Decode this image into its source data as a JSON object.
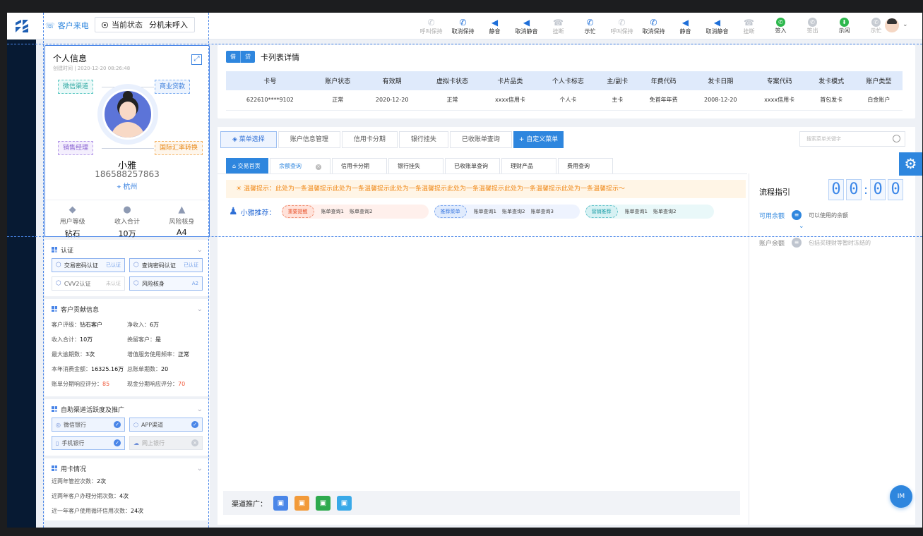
{
  "topbar": {
    "caller_label": "客户来电",
    "status_label": "当前状态",
    "status_value": "分机未呼入",
    "buttons": [
      {
        "label": "呼叫保持",
        "icon": "phone-hold-icon",
        "enabled": false
      },
      {
        "label": "取消保持",
        "icon": "phone-unhold-icon",
        "enabled": true
      },
      {
        "label": "静音",
        "icon": "mute-icon",
        "enabled": true
      },
      {
        "label": "取消静音",
        "icon": "unmute-icon",
        "enabled": true
      },
      {
        "label": "挂断",
        "icon": "hangup-icon",
        "enabled": false
      },
      {
        "label": "示忙",
        "icon": "busy-icon",
        "enabled": true
      },
      {
        "label": "呼叫保持",
        "icon": "phone-hold-icon",
        "enabled": false
      },
      {
        "label": "取消保持",
        "icon": "phone-unhold-icon",
        "enabled": true
      },
      {
        "label": "静音",
        "icon": "mute-icon",
        "enabled": true
      },
      {
        "label": "取消静音",
        "icon": "unmute-icon",
        "enabled": true
      },
      {
        "label": "挂断",
        "icon": "hangup-icon",
        "enabled": false
      },
      {
        "label": "签入",
        "icon": "sign-in-icon",
        "enabled": true
      },
      {
        "label": "签出",
        "icon": "sign-out-icon",
        "enabled": false
      },
      {
        "label": "示闲",
        "icon": "idle-icon",
        "enabled": true
      },
      {
        "label": "示忙",
        "icon": "busy-icon",
        "enabled": false
      }
    ]
  },
  "profile": {
    "title": "个人信息",
    "created": "创建时间 | 2020-12-20 08:26:48",
    "tags": [
      "微信渠道",
      "商业贷款",
      "销售经理",
      "国际汇率转换"
    ],
    "name": "小雅",
    "phone": "186588257863",
    "location": "杭州",
    "stats": [
      {
        "label": "用户等级",
        "value": "钻石"
      },
      {
        "label": "收入合计",
        "value": "10万"
      },
      {
        "label": "风险核身",
        "value": "A4"
      }
    ]
  },
  "auth": {
    "title": "认证",
    "items": [
      {
        "label": "交易密码认证",
        "status": "已认证"
      },
      {
        "label": "查询密码认证",
        "status": "已认证"
      },
      {
        "label": "CVV2认证",
        "status": "未认证"
      },
      {
        "label": "风险核身",
        "status": "A2"
      }
    ]
  },
  "contribution": {
    "title": "客户贡献信息",
    "rows": [
      {
        "k": "客户评级：",
        "v": "钻石客户"
      },
      {
        "k": "净收入：",
        "v": "6万"
      },
      {
        "k": "收入合计：",
        "v": "10万"
      },
      {
        "k": "挽留客户：",
        "v": "是"
      },
      {
        "k": "最大逾期数：",
        "v": "3次"
      },
      {
        "k": "增值服务使用频率：",
        "v": "正常"
      },
      {
        "k": "本年消费金额：",
        "v": "16325.16万"
      },
      {
        "k": "总账单期数：",
        "v": "20"
      },
      {
        "k": "账单分期响应评分：",
        "v": "85"
      },
      {
        "k": "现金分期响应评分：",
        "v": "70"
      }
    ]
  },
  "channels": {
    "title": "自助渠道活跃度及推广",
    "items": [
      {
        "label": "微信银行",
        "on": true
      },
      {
        "label": "APP渠道",
        "on": true
      },
      {
        "label": "手机银行",
        "on": true
      },
      {
        "label": "网上银行",
        "on": false
      }
    ]
  },
  "usage": {
    "title": "用卡情况",
    "rows": [
      {
        "k": "近两年管控次数：",
        "v": "2次"
      },
      {
        "k": "近两年客户办理分期次数：",
        "v": "4次"
      },
      {
        "k": "近一年客户使用循环信用次数：",
        "v": "24次"
      }
    ]
  },
  "cards": {
    "badges": [
      "借",
      "贷"
    ],
    "title": "卡列表详情",
    "headers": [
      "卡号",
      "账户状态",
      "有效期",
      "虚拟卡状态",
      "卡片品类",
      "个人卡标志",
      "主/副卡",
      "年费代码",
      "发卡日期",
      "专案代码",
      "发卡模式",
      "账户类型"
    ],
    "rows": [
      [
        "622610****9102",
        "正常",
        "2020-12-20",
        "正常",
        "xxxx信用卡",
        "个人卡",
        "主卡",
        "免首年年费",
        "2008-12-20",
        "xxxx信用卡",
        "首包发卡",
        "白金账户"
      ]
    ]
  },
  "menu": {
    "tabs": [
      "菜单选择",
      "账户信息管理",
      "信用卡分期",
      "银行挂失",
      "已收账单查询"
    ],
    "add_label": "+ 自定义菜单",
    "search_placeholder": "搜索菜单关键字"
  },
  "subtabs": {
    "home": "交易首页",
    "items": [
      "余额查询",
      "信用卡分期",
      "银行挂失",
      "已收账单查询",
      "理财产品",
      "费用查询"
    ]
  },
  "tip": "温馨提示：此处为一条温馨提示此处为一条温馨提示此处为一条温馨提示此处为一条温馨提示此处为一条温馨提示此处为一条温馨提示～",
  "recommend": {
    "label": "小雅推荐：",
    "groups": [
      {
        "pill": "重要提醒",
        "items": [
          "账单查询1",
          "账单查询2"
        ]
      },
      {
        "pill": "推荐菜单",
        "items": [
          "账单查询1",
          "账单查询2",
          "账单查询3"
        ]
      },
      {
        "pill": "营销推荐",
        "items": [
          "账单查询1",
          "账单查询2"
        ]
      }
    ]
  },
  "channel_promo": {
    "label": "渠道推广："
  },
  "flow": {
    "title": "流程指引",
    "timer": [
      "0",
      "0",
      "0",
      "0"
    ],
    "steps": [
      {
        "label": "可用余额",
        "desc": "可以使用的余额"
      },
      {
        "label": "账户余额",
        "desc": "包括买理财等暂时冻结的"
      }
    ]
  },
  "im_label": "IM",
  "colors": {
    "accent": "#2e86de",
    "sidebar": "#071a33"
  }
}
